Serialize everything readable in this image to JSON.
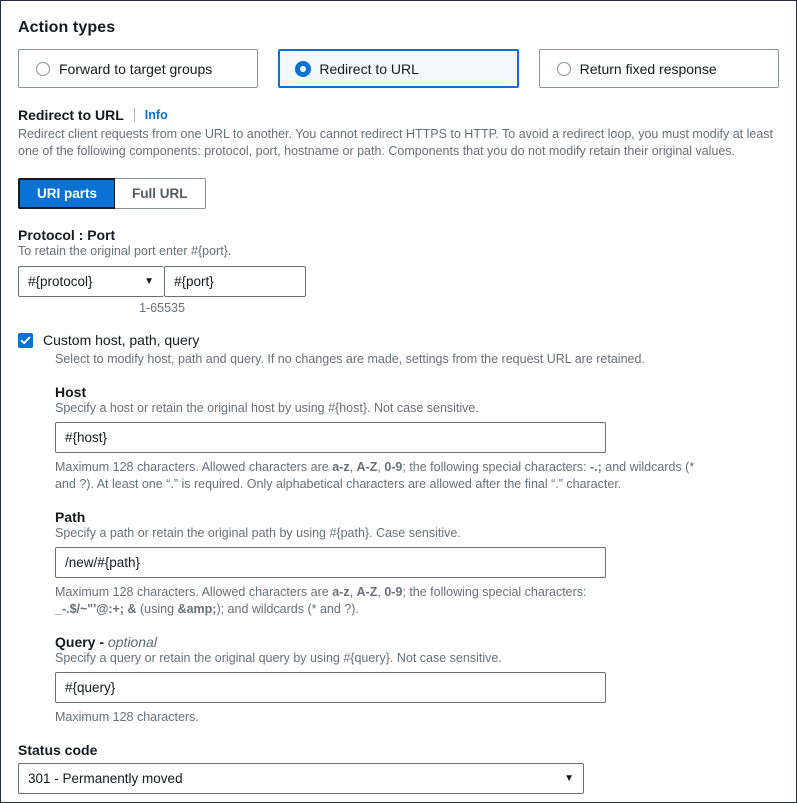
{
  "action_types": {
    "title": "Action types",
    "options": [
      {
        "label": "Forward to target groups",
        "selected": false
      },
      {
        "label": "Redirect to URL",
        "selected": true
      },
      {
        "label": "Return fixed response",
        "selected": false
      }
    ]
  },
  "redirect": {
    "label": "Redirect to URL",
    "info_label": "Info",
    "description": "Redirect client requests from one URL to another. You cannot redirect HTTPS to HTTP. To avoid a redirect loop, you must modify at least one of the following components: protocol, port, hostname or path. Components that you do not modify retain their original values.",
    "segments": [
      {
        "label": "URI parts",
        "active": true
      },
      {
        "label": "Full URL",
        "active": false
      }
    ]
  },
  "protocol_port": {
    "label": "Protocol : Port",
    "hint": "To retain the original port enter #{port}.",
    "protocol_value": "#{protocol}",
    "port_value": "#{port}",
    "port_placeholder": "#{port}",
    "range_hint": "1-65535"
  },
  "custom": {
    "checkbox_label": "Custom host, path, query",
    "checkbox_checked": true,
    "checkbox_hint": "Select to modify host, path and query. If no changes are made, settings from the request URL are retained.",
    "host": {
      "label": "Host",
      "hint": "Specify a host or retain the original host by using #{host}. Not case sensitive.",
      "value": "#{host}",
      "constraint_prefix": "Maximum 128 characters. Allowed characters are ",
      "constraint_bold_1": "a-z",
      "constraint_mid_1": ", ",
      "constraint_bold_2": "A-Z",
      "constraint_mid_2": ", ",
      "constraint_bold_3": "0-9",
      "constraint_mid_3": "; the following special characters: ",
      "constraint_bold_4": "-.;",
      "constraint_suffix": " and wildcards (* and ?). At least one “.” is required. Only alphabetical characters are allowed after the final “.” character."
    },
    "path": {
      "label": "Path",
      "hint": "Specify a path or retain the original path by using #{path}. Case sensitive.",
      "value": "/new/#{path}",
      "constraint_prefix": "Maximum 128 characters. Allowed characters are ",
      "constraint_bold_1": "a-z",
      "constraint_mid_1": ", ",
      "constraint_bold_2": "A-Z",
      "constraint_mid_2": ", ",
      "constraint_bold_3": "0-9",
      "constraint_mid_3": "; the following special characters: ",
      "constraint_bold_4": "_-.$/~\"'@:+;",
      "constraint_mid_4": " ",
      "constraint_bold_5": "&",
      "constraint_mid_5": " (using ",
      "constraint_bold_6": "&amp;",
      "constraint_suffix": "); and wildcards (* and ?)."
    },
    "query": {
      "label": "Query - ",
      "label_optional": "optional",
      "hint": "Specify a query or retain the original query by using #{query}. Not case sensitive.",
      "value": "#{query}",
      "constraint": "Maximum 128 characters."
    }
  },
  "status_code": {
    "label": "Status code",
    "value": "301 - Permanently moved"
  },
  "icons": {
    "caret_down": "▼"
  },
  "colors": {
    "accent": "#0972d3",
    "selected_tile_bg": "#f2f8fd",
    "text": "#16191f",
    "muted": "#687078",
    "border": "#687078"
  }
}
